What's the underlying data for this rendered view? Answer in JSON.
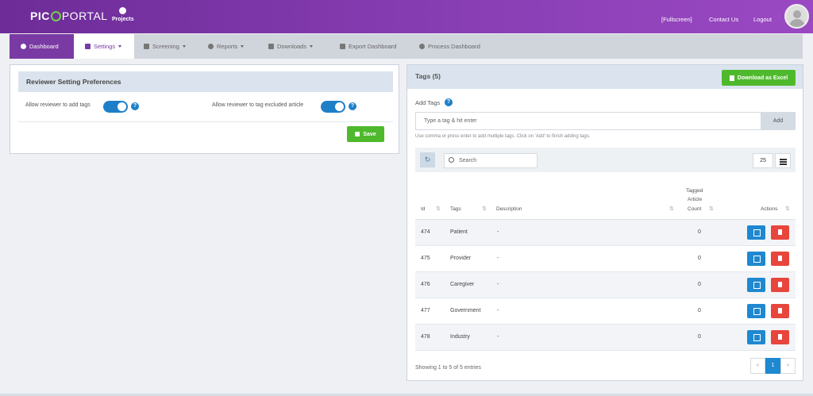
{
  "topbar": {
    "logo_a": "PIC",
    "logo_b": "PORTAL",
    "projects": "Projects",
    "fullscreen": "[Fullscreen]",
    "contact": "Contact Us",
    "logout": "Logout"
  },
  "nav": {
    "dashboard": "Dashboard",
    "settings": "Settings",
    "screening": "Screening",
    "reports": "Reports",
    "downloads": "Downloads",
    "export_dashboard": "Export Dashboard",
    "process_dashboard": "Process Dashboard"
  },
  "reviewer": {
    "title": "Reviewer Setting Preferences",
    "pref1": "Allow reviewer to add tags",
    "pref2": "Allow reviewer to tag excluded article",
    "pref1_on": true,
    "pref2_on": true,
    "save": "Save"
  },
  "tags": {
    "title": "Tags (5)",
    "download": "Download as Excel",
    "add_label": "Add Tags",
    "input_placeholder": "Type a tag & hit enter",
    "add_button": "Add",
    "hint": "Use comma or press enter to add multiple tags. Click on 'Add' to finish adding tags.",
    "search_placeholder": "Search",
    "page_size": "25",
    "columns": {
      "id": "Id",
      "tags": "Tags",
      "description": "Description",
      "count_1": "Tagged",
      "count_2": "Article",
      "count_3": "Count",
      "actions": "Actions"
    },
    "rows": [
      {
        "id": "474",
        "tag": "Patient",
        "description": "-",
        "count": "0"
      },
      {
        "id": "475",
        "tag": "Provider",
        "description": "-",
        "count": "0"
      },
      {
        "id": "476",
        "tag": "Caregiver",
        "description": "-",
        "count": "0"
      },
      {
        "id": "477",
        "tag": "Government",
        "description": "-",
        "count": "0"
      },
      {
        "id": "478",
        "tag": "Industry",
        "description": "-",
        "count": "0"
      }
    ],
    "showing": "Showing 1 to 5 of 5 entries",
    "pager": {
      "prev": "«",
      "current": "1",
      "next": "»"
    }
  },
  "colors": {
    "brand_purple": "#7a3aa3",
    "accent_blue": "#1e88d0",
    "success_green": "#4fb92d",
    "danger_red": "#e8453c"
  }
}
